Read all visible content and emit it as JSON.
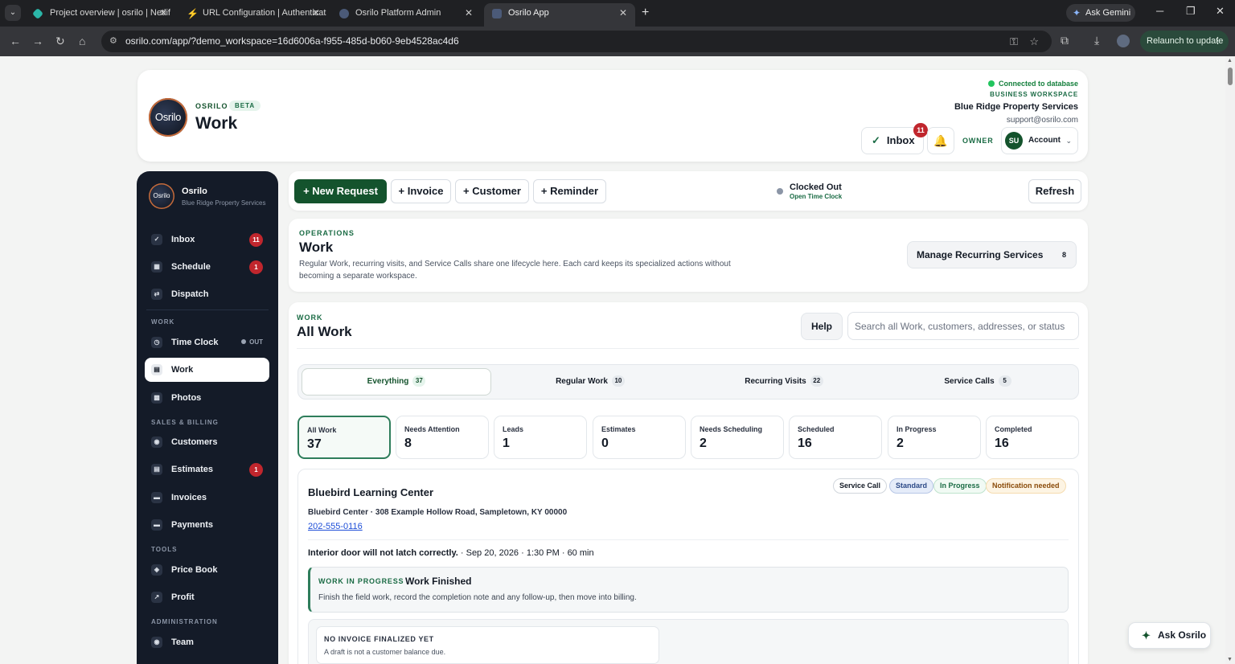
{
  "browser": {
    "tabs": [
      {
        "title": "Project overview | osrilo | Netlif",
        "favicon_color": "#2bb6a8"
      },
      {
        "title": "URL Configuration | Authenticat",
        "favicon_color": "#3ecf8e"
      },
      {
        "title": "Osrilo Platform Admin",
        "favicon_color": "#4b5a78"
      },
      {
        "title": "Osrilo App",
        "favicon_color": "#4b5a78"
      }
    ],
    "gemini_label": "Ask Gemini",
    "url": "osrilo.com/app/?demo_workspace=16d6006a-f955-485d-b060-9eb4528ac4d6",
    "relaunch_label": "Relaunch to update"
  },
  "header": {
    "logo_text": "Osrilo",
    "brand": "OSRILO",
    "beta": "BETA",
    "title": "Work",
    "db_status": "Connected to database",
    "workspace_label": "BUSINESS WORKSPACE",
    "business_name": "Blue Ridge Property Services",
    "email": "support@osrilo.com",
    "inbox_label": "Inbox",
    "inbox_count": "11",
    "role": "OWNER",
    "avatar_initials": "SU",
    "account_label": "Account"
  },
  "sidebar": {
    "logo_text": "Osrilo",
    "name": "Osrilo",
    "subtitle": "Blue Ridge Property Services",
    "top_items": [
      {
        "label": "Inbox",
        "icon": "✓",
        "badge": "11"
      },
      {
        "label": "Schedule",
        "icon": "▦",
        "badge": "1"
      },
      {
        "label": "Dispatch",
        "icon": "⇄"
      }
    ],
    "sections": {
      "work": "WORK",
      "sales": "SALES & BILLING",
      "tools": "TOOLS",
      "admin": "ADMINISTRATION"
    },
    "work_items": [
      {
        "label": "Time Clock",
        "icon": "◷",
        "status": "OUT"
      },
      {
        "label": "Work",
        "icon": "▤"
      },
      {
        "label": "Photos",
        "icon": "▩"
      }
    ],
    "sales_items": [
      {
        "label": "Customers",
        "icon": "◉"
      },
      {
        "label": "Estimates",
        "icon": "▤",
        "badge": "1"
      },
      {
        "label": "Invoices",
        "icon": "▬"
      },
      {
        "label": "Payments",
        "icon": "▬"
      }
    ],
    "tools_items": [
      {
        "label": "Price Book",
        "icon": "◈"
      },
      {
        "label": "Profit",
        "icon": "↗"
      }
    ],
    "admin_items": [
      {
        "label": "Team",
        "icon": "◉"
      }
    ]
  },
  "actions": {
    "new_request": "+ New Request",
    "invoice": "+ Invoice",
    "customer": "+ Customer",
    "reminder": "+ Reminder",
    "clock_status": "Clocked Out",
    "clock_link": "Open Time Clock",
    "refresh": "Refresh"
  },
  "operations": {
    "eyebrow": "OPERATIONS",
    "title": "Work",
    "description": "Regular Work, recurring visits, and Service Calls share one lifecycle here. Each card keeps its specialized actions without becoming a separate workspace.",
    "recurring_label": "Manage Recurring Services",
    "recurring_count": "8"
  },
  "work": {
    "eyebrow": "WORK",
    "title": "All Work",
    "help": "Help",
    "search_placeholder": "Search all Work, customers, addresses, or status",
    "segments": [
      {
        "label": "Everything",
        "count": "37"
      },
      {
        "label": "Regular Work",
        "count": "10"
      },
      {
        "label": "Recurring Visits",
        "count": "22"
      },
      {
        "label": "Service Calls",
        "count": "5"
      }
    ],
    "stats": [
      {
        "label": "All Work",
        "value": "37"
      },
      {
        "label": "Needs Attention",
        "value": "8"
      },
      {
        "label": "Leads",
        "value": "1"
      },
      {
        "label": "Estimates",
        "value": "0"
      },
      {
        "label": "Needs Scheduling",
        "value": "2"
      },
      {
        "label": "Scheduled",
        "value": "16"
      },
      {
        "label": "In Progress",
        "value": "2"
      },
      {
        "label": "Completed",
        "value": "16"
      }
    ]
  },
  "job": {
    "title": "Bluebird Learning Center",
    "chips": {
      "type": "Service Call",
      "priority": "Standard",
      "status": "In Progress",
      "notice": "Notification needed"
    },
    "address": "Bluebird Center · 308 Example Hollow Road, Sampletown, KY 00000",
    "phone": "202-555-0116",
    "issue": "Interior door will not latch correctly.",
    "issue_meta": " · Sep 20, 2026 · 1:30 PM · 60 min",
    "wip_eyebrow": "WORK IN PROGRESS",
    "wip_title": "Work Finished",
    "wip_desc": "Finish the field work, record the completion note and any follow-up, then move into billing.",
    "invoice_title": "NO INVOICE FINALIZED YET",
    "invoice_desc": "A draft is not a customer balance due."
  },
  "assistant": {
    "label": "Ask Osrilo"
  }
}
